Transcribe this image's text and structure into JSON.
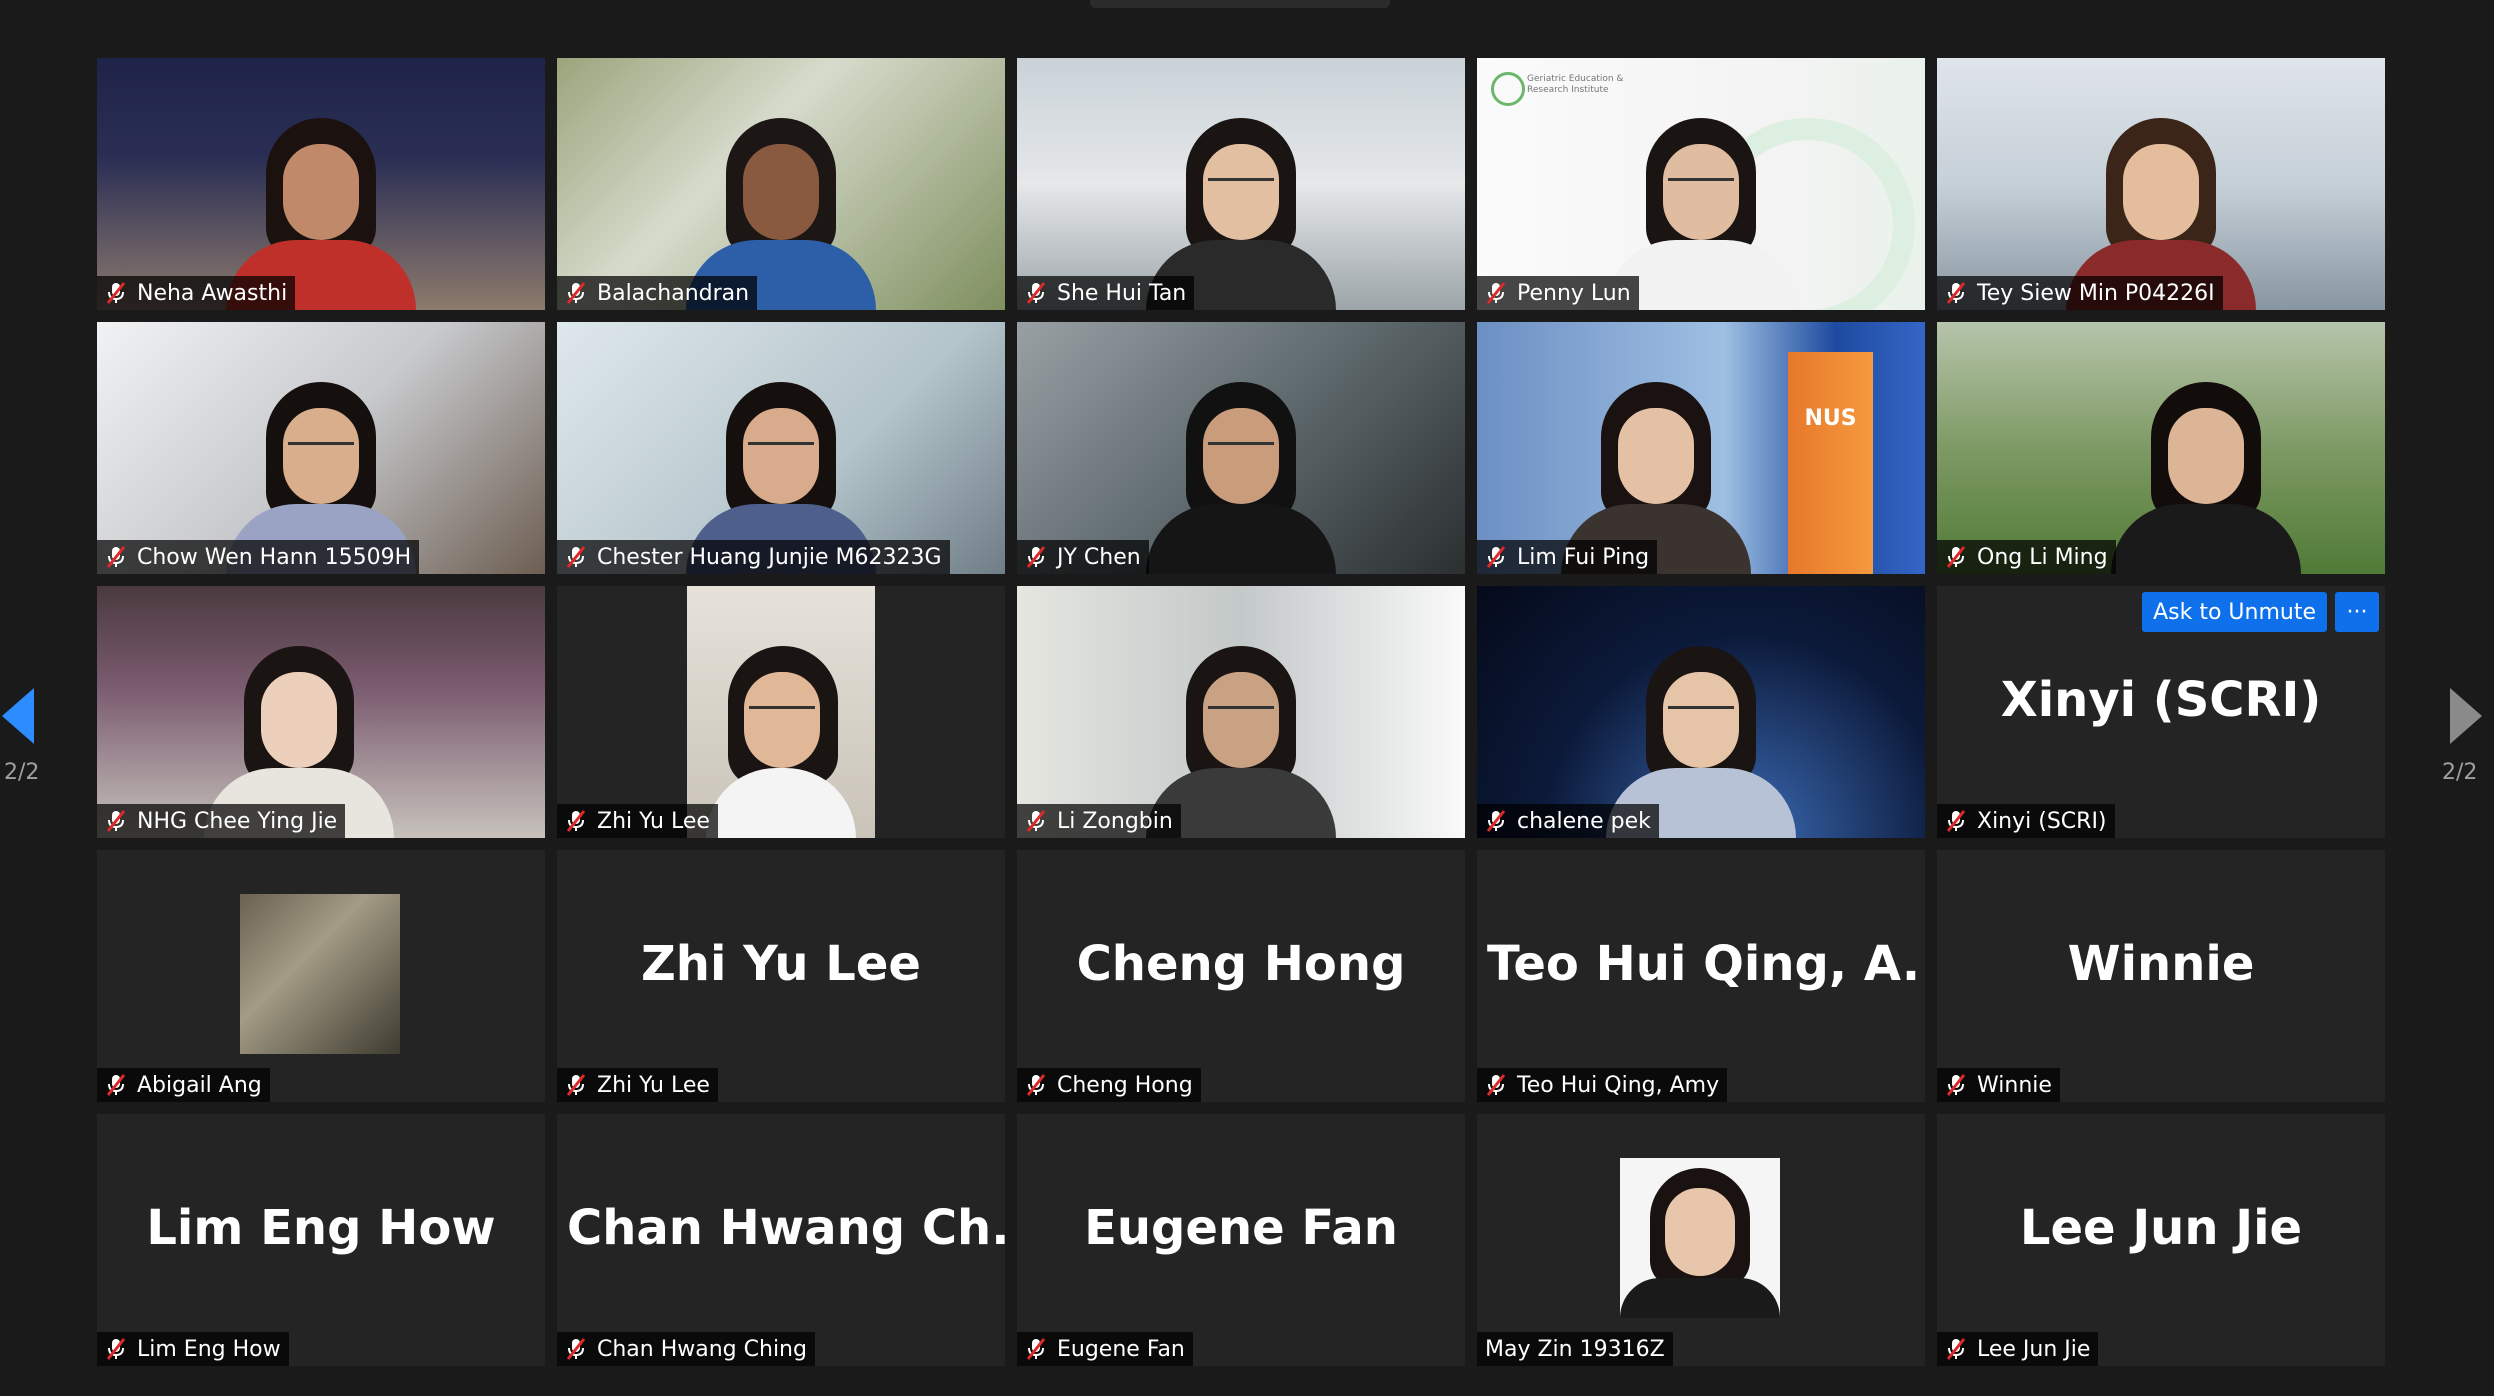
{
  "pagination": {
    "left": "2/2",
    "right": "2/2"
  },
  "colors": {
    "accent": "#0e71eb",
    "mute": "#e02828",
    "tile": "#242424",
    "background": "#1a1a1a"
  },
  "participants": [
    {
      "name": "Neha Awasthi",
      "muted": true,
      "video": true
    },
    {
      "name": "Balachandran",
      "muted": true,
      "video": true
    },
    {
      "name": "She Hui Tan",
      "muted": true,
      "video": true
    },
    {
      "name": "Penny Lun",
      "muted": true,
      "video": true,
      "background_text": "Geriatric Education & Research Institute"
    },
    {
      "name": "Tey Siew Min P04226I",
      "muted": true,
      "video": true
    },
    {
      "name": "Chow Wen Hann 15509H",
      "muted": true,
      "video": true
    },
    {
      "name": "Chester Huang Junjie M62323G",
      "muted": true,
      "video": true
    },
    {
      "name": "JY Chen",
      "muted": true,
      "video": true
    },
    {
      "name": "Lim Fui Ping",
      "muted": true,
      "video": true,
      "background_text": "NUS"
    },
    {
      "name": "Ong Li Ming",
      "muted": true,
      "video": true
    },
    {
      "name": "NHG Chee Ying Jie",
      "muted": true,
      "video": true
    },
    {
      "name": "Zhi Yu Lee",
      "muted": true,
      "video": true
    },
    {
      "name": "Li Zongbin",
      "muted": true,
      "video": true
    },
    {
      "name": "chalene pek",
      "muted": true,
      "video": true
    },
    {
      "name": "Xinyi (SCRI)",
      "display": "Xinyi (SCRI)",
      "muted": true,
      "video": false,
      "ask_to_unmute": "Ask to Unmute",
      "more": "···"
    },
    {
      "name": "Abigail Ang",
      "muted": true,
      "video": false,
      "avatar": "pond-photo"
    },
    {
      "name": "Zhi Yu Lee",
      "display": "Zhi Yu Lee",
      "muted": true,
      "video": false
    },
    {
      "name": "Cheng Hong",
      "display": "Cheng Hong",
      "muted": true,
      "video": false
    },
    {
      "name": "Teo Hui Qing, Amy",
      "display": "Teo Hui Qing, A...",
      "muted": true,
      "video": false
    },
    {
      "name": "Winnie",
      "display": "Winnie",
      "muted": true,
      "video": false
    },
    {
      "name": "Lim Eng How",
      "display": "Lim Eng How",
      "muted": true,
      "video": false
    },
    {
      "name": "Chan Hwang Ching",
      "display": "Chan Hwang Ch...",
      "muted": true,
      "video": false
    },
    {
      "name": "Eugene Fan",
      "display": "Eugene Fan",
      "muted": true,
      "video": false
    },
    {
      "name": "May Zin 19316Z",
      "muted": false,
      "video": false,
      "avatar": "profile-photo"
    },
    {
      "name": "Lee Jun Jie",
      "display": "Lee Jun Jie",
      "muted": true,
      "video": false
    }
  ]
}
